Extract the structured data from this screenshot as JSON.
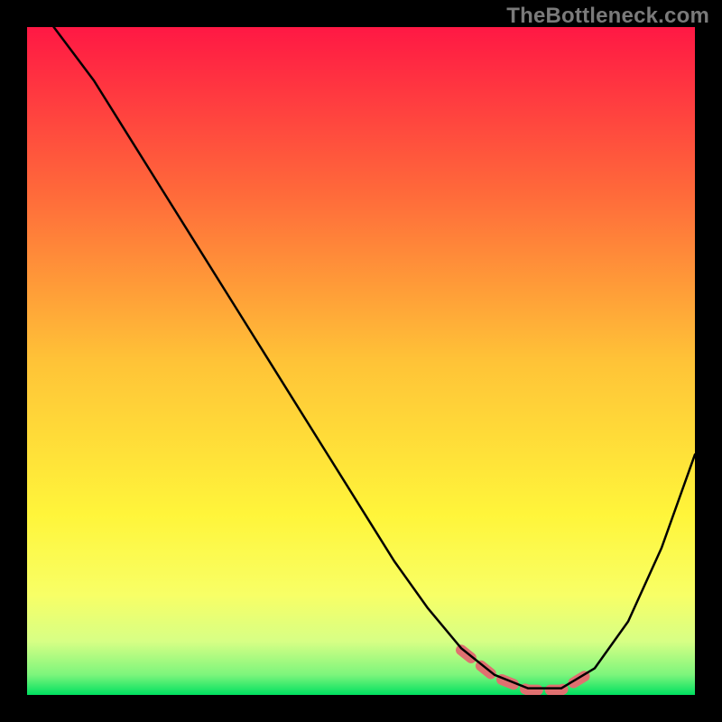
{
  "watermark": "TheBottleneck.com",
  "chart_data": {
    "type": "line",
    "title": "",
    "xlabel": "",
    "ylabel": "",
    "xlim": [
      0,
      100
    ],
    "ylim": [
      0,
      100
    ],
    "grid": false,
    "legend": false,
    "series": [
      {
        "name": "bottleneck-curve",
        "x": [
          4,
          10,
          15,
          20,
          25,
          30,
          35,
          40,
          45,
          50,
          55,
          60,
          65,
          70,
          75,
          80,
          85,
          90,
          95,
          100
        ],
        "y": [
          100,
          92,
          84,
          76,
          68,
          60,
          52,
          44,
          36,
          28,
          20,
          13,
          7,
          3,
          1,
          1,
          4,
          11,
          22,
          36
        ],
        "color": "#000000"
      },
      {
        "name": "optimal-range-marker",
        "x": [
          65,
          85
        ],
        "y": [
          2,
          2
        ],
        "color": "#e07070",
        "style": "dashed-thick"
      }
    ],
    "background_gradient": {
      "stops": [
        {
          "pos": 0.0,
          "color": "#ff1844"
        },
        {
          "pos": 0.25,
          "color": "#ff6a3a"
        },
        {
          "pos": 0.5,
          "color": "#ffc337"
        },
        {
          "pos": 0.73,
          "color": "#fff53a"
        },
        {
          "pos": 0.85,
          "color": "#f8ff66"
        },
        {
          "pos": 0.92,
          "color": "#d7ff85"
        },
        {
          "pos": 0.97,
          "color": "#7cf57c"
        },
        {
          "pos": 1.0,
          "color": "#00e060"
        }
      ]
    }
  }
}
